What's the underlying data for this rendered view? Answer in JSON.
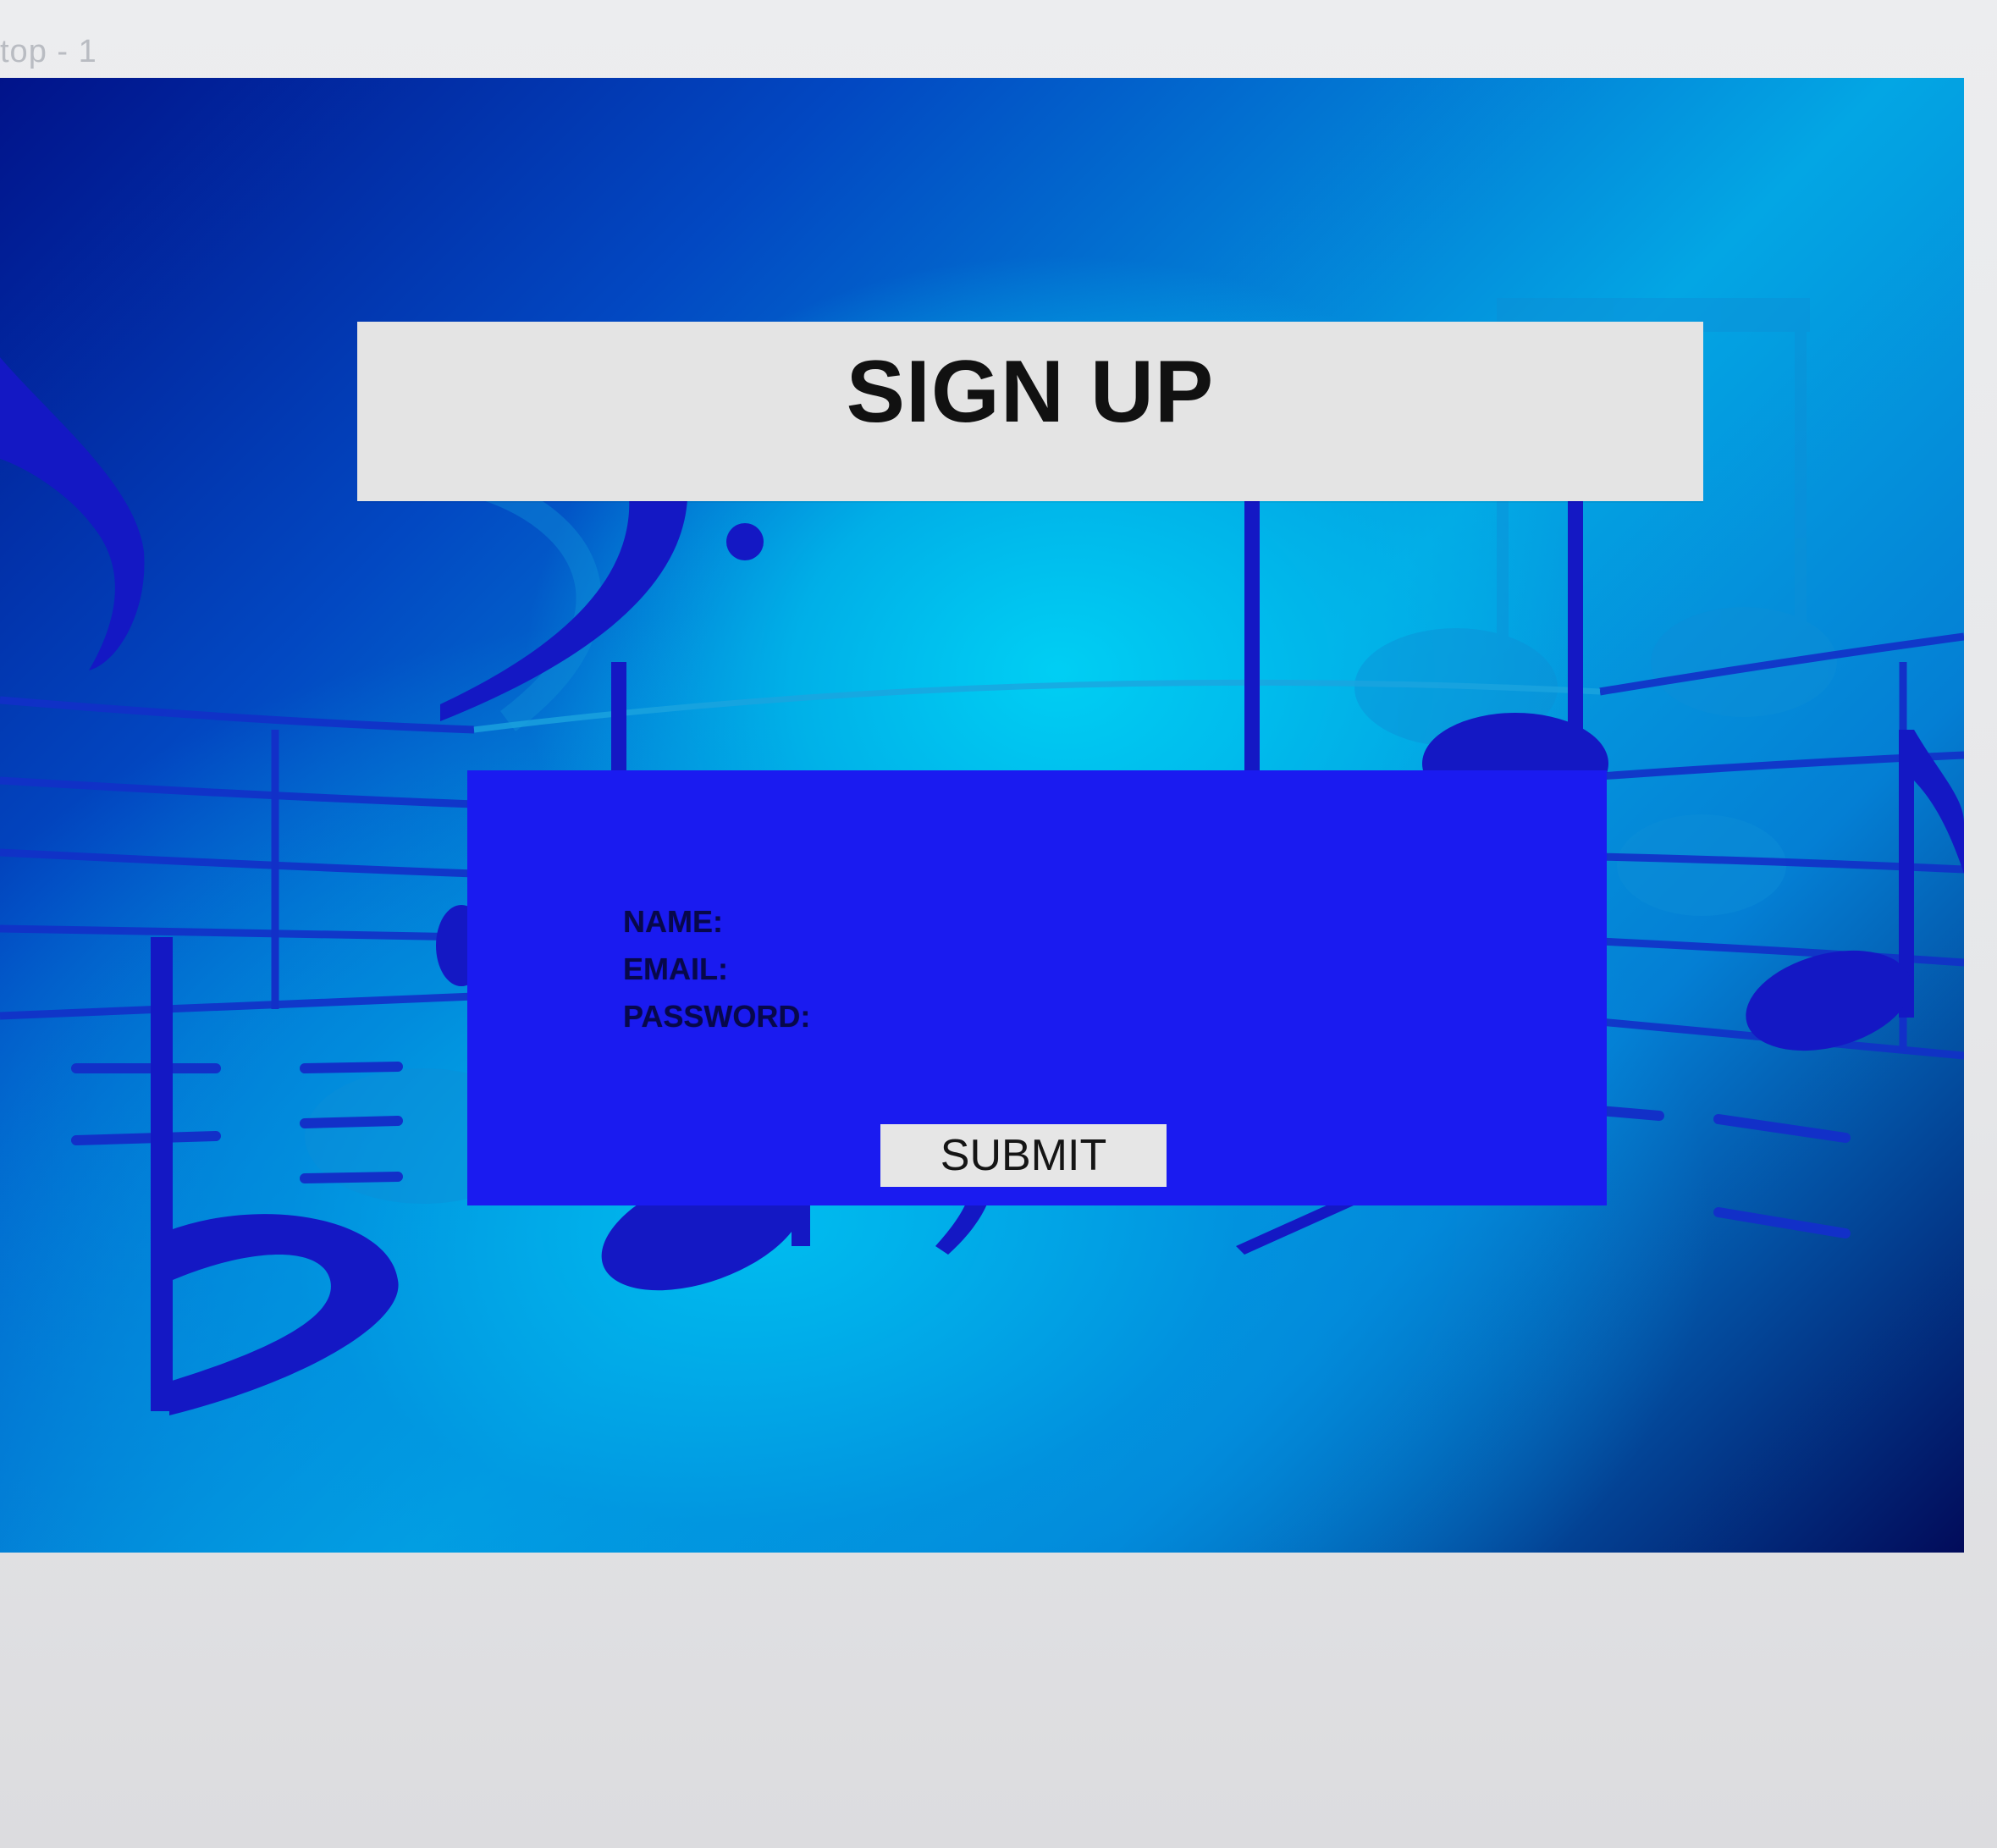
{
  "frame": {
    "label": "top - 1"
  },
  "header": {
    "title": "SIGN UP"
  },
  "form": {
    "name_label": "NAME:",
    "email_label": "EMAIL:",
    "password_label": "PASSWORD:",
    "submit_label": "SUBMIT"
  },
  "colors": {
    "panel": "#1a1bf0",
    "title_bar": "#e4e4e4",
    "button": "#e6e6e6",
    "background_dark": "#020b5a",
    "background_light": "#03a6e4"
  },
  "background": {
    "motif": "music-notes-and-staff-lines"
  }
}
